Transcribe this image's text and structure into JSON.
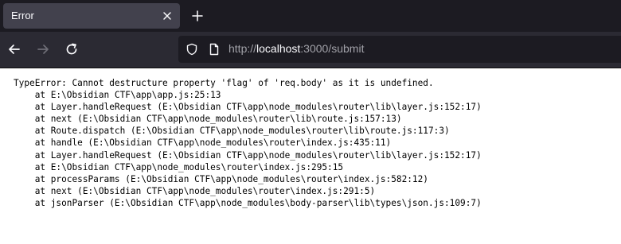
{
  "tab": {
    "title": "Error"
  },
  "toolbar": {
    "url_scheme_host": "http://",
    "url_host": "localhost",
    "url_rest": ":3000/submit"
  },
  "error": {
    "message": "TypeError: Cannot destructure property 'flag' of 'req.body' as it is undefined.",
    "stack": [
      "    at E:\\Obsidian CTF\\app\\app.js:25:13",
      "    at Layer.handleRequest (E:\\Obsidian CTF\\app\\node_modules\\router\\lib\\layer.js:152:17)",
      "    at next (E:\\Obsidian CTF\\app\\node_modules\\router\\lib\\route.js:157:13)",
      "    at Route.dispatch (E:\\Obsidian CTF\\app\\node_modules\\router\\lib\\route.js:117:3)",
      "    at handle (E:\\Obsidian CTF\\app\\node_modules\\router\\index.js:435:11)",
      "    at Layer.handleRequest (E:\\Obsidian CTF\\app\\node_modules\\router\\lib\\layer.js:152:17)",
      "    at E:\\Obsidian CTF\\app\\node_modules\\router\\index.js:295:15",
      "    at processParams (E:\\Obsidian CTF\\app\\node_modules\\router\\index.js:582:12)",
      "    at next (E:\\Obsidian CTF\\app\\node_modules\\router\\index.js:291:5)",
      "    at jsonParser (E:\\Obsidian CTF\\app\\node_modules\\body-parser\\lib\\types\\json.js:109:7)"
    ]
  },
  "icons": {
    "tab_close": "close-icon",
    "new_tab": "plus-icon",
    "back": "arrow-left-icon",
    "forward": "arrow-right-icon",
    "reload": "reload-icon",
    "tracking": "shield-icon",
    "page_info": "page-icon"
  }
}
